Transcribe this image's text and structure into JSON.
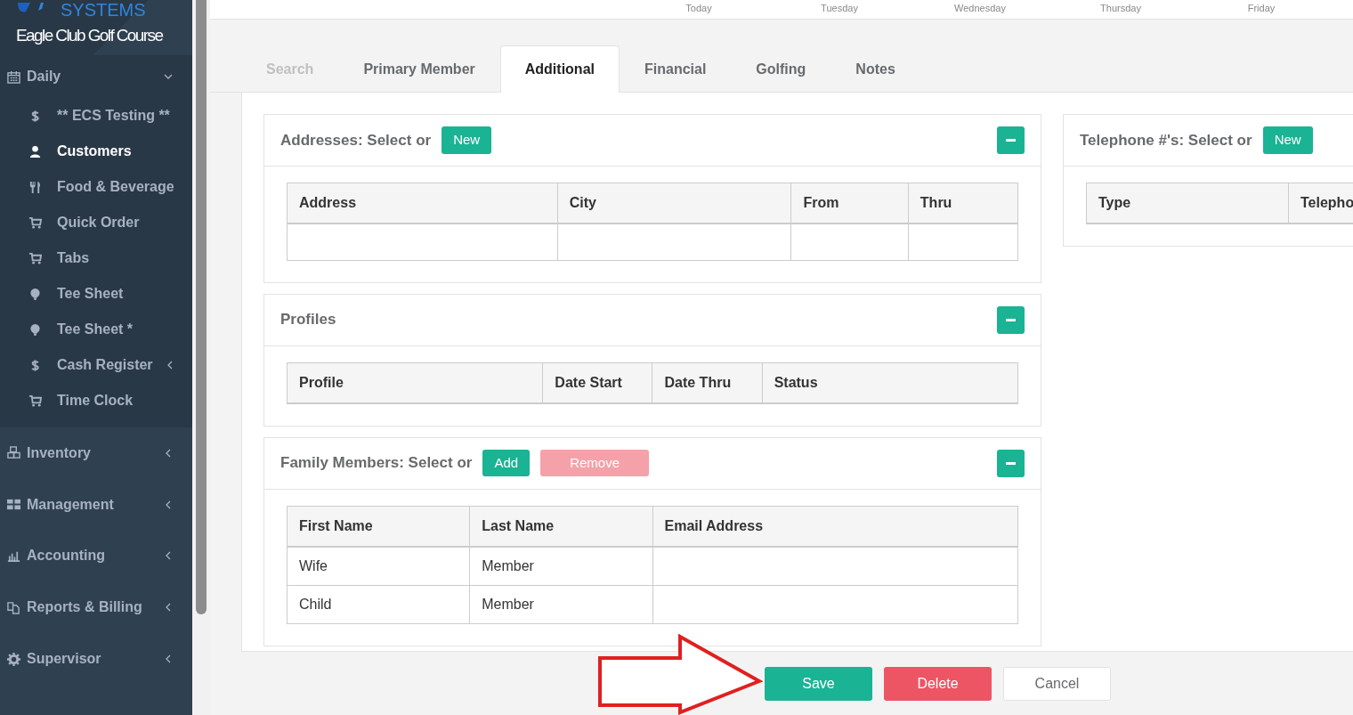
{
  "sidebar": {
    "brand": "SYSTEMS",
    "club_name": "Eagle Club Golf Course",
    "groups": [
      {
        "label": "Daily",
        "expanded": true,
        "items": [
          {
            "label": "** ECS Testing **",
            "selected": false,
            "has_submenu": false
          },
          {
            "label": "Customers",
            "selected": true,
            "has_submenu": false
          },
          {
            "label": "Food & Beverage",
            "selected": false,
            "has_submenu": false
          },
          {
            "label": "Quick Order",
            "selected": false,
            "has_submenu": false
          },
          {
            "label": "Tabs",
            "selected": false,
            "has_submenu": false
          },
          {
            "label": "Tee Sheet",
            "selected": false,
            "has_submenu": false
          },
          {
            "label": "Tee Sheet *",
            "selected": false,
            "has_submenu": false
          },
          {
            "label": "Cash Register",
            "selected": false,
            "has_submenu": true
          },
          {
            "label": "Time Clock",
            "selected": false,
            "has_submenu": false
          }
        ]
      },
      {
        "label": "Inventory",
        "expanded": false
      },
      {
        "label": "Management",
        "expanded": false
      },
      {
        "label": "Accounting",
        "expanded": false
      },
      {
        "label": "Reports & Billing",
        "expanded": false
      },
      {
        "label": "Supervisor",
        "expanded": false
      }
    ]
  },
  "week_days": [
    "Today",
    "Tuesday",
    "Wednesday",
    "Thursday",
    "Friday"
  ],
  "tabs": [
    {
      "label": "Search",
      "selected": false,
      "disabled": true
    },
    {
      "label": "Primary Member",
      "selected": false,
      "disabled": false
    },
    {
      "label": "Additional",
      "selected": true,
      "disabled": false
    },
    {
      "label": "Financial",
      "selected": false,
      "disabled": false
    },
    {
      "label": "Golfing",
      "selected": false,
      "disabled": false
    },
    {
      "label": "Notes",
      "selected": false,
      "disabled": false
    }
  ],
  "left_panels": [
    {
      "title": "Addresses: Select or",
      "buttons": [
        {
          "label": "New",
          "kind": "success",
          "disabled": false
        }
      ],
      "columns": [
        "Address",
        "City",
        "From",
        "Thru"
      ],
      "blank_row": true
    },
    {
      "title": "Profiles",
      "columns": [
        "Profile",
        "Date Start",
        "Date Thru",
        "Status"
      ]
    },
    {
      "title": "Family Members: Select or",
      "buttons": [
        {
          "label": "Add",
          "kind": "success",
          "disabled": false
        },
        {
          "label": "Remove",
          "kind": "danger",
          "disabled": true
        }
      ],
      "columns": [
        "First Name",
        "Last Name",
        "Email Address"
      ],
      "rows": [
        [
          "Wife",
          "Member"
        ],
        [
          "Child",
          "Member"
        ]
      ]
    }
  ],
  "right_panels": [
    {
      "title": "Telephone #'s: Select or",
      "buttons": [
        {
          "label": "New",
          "kind": "success",
          "disabled": false
        }
      ],
      "columns": [
        "Type",
        "Telepho"
      ]
    }
  ],
  "actions": [
    {
      "label": "Save",
      "kind": "save"
    },
    {
      "label": "Delete",
      "kind": "delete"
    },
    {
      "label": "Cancel",
      "kind": "cancel"
    }
  ]
}
